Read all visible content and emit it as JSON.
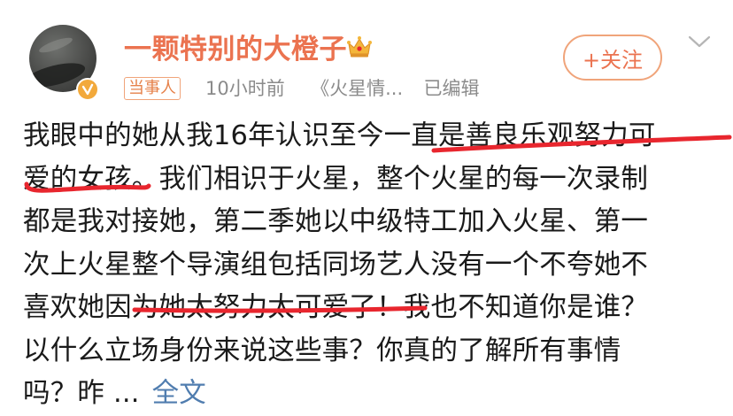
{
  "user": {
    "name": "一颗特别的大橙子",
    "tag": "当事人",
    "time": "10小时前",
    "source": "《火星情...",
    "edited": "已编辑"
  },
  "follow_label": "+关注",
  "post": {
    "lines": [
      "我眼中的她从我16年认识至今一直是善良乐观努力可",
      "爱的女孩。我们相识于火星，整个火星的每一次录制",
      "都是我对接她，第二季她以中级特工加入火星、第一",
      "次上火星整个导演组包括同场艺人没有一个不夸她不",
      "喜欢她因为她太努力太可爱了！我也不知道你是谁？",
      "以什么立场身份来说这些事？你真的了解所有事情",
      "吗？昨"
    ],
    "ellipsis": "...",
    "full_text": "全文"
  },
  "colors": {
    "name": "#eb7350",
    "link": "#507daf",
    "underline": "#e8262e",
    "meta": "#8b8b8b"
  },
  "icons": [
    "crown-icon",
    "verified-icon",
    "chevron-down-icon"
  ]
}
